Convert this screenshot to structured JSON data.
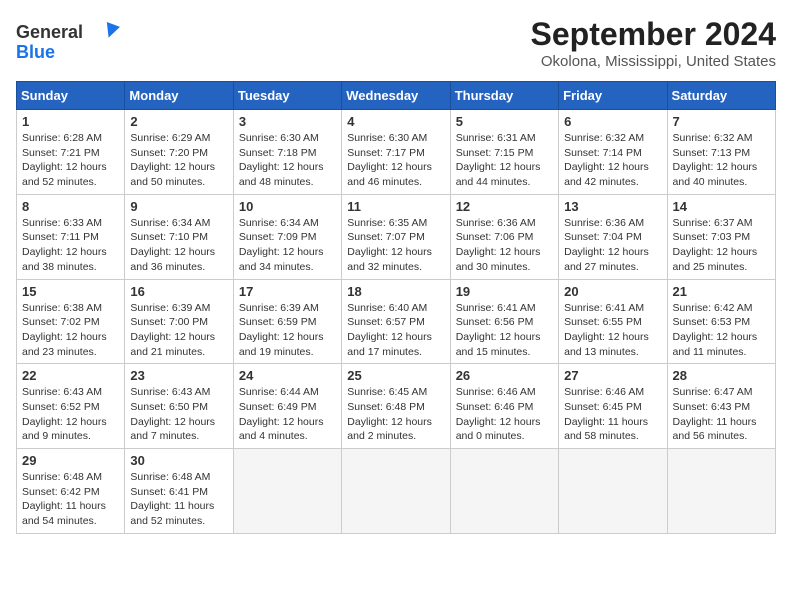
{
  "header": {
    "logo_line1": "General",
    "logo_line2": "Blue",
    "title": "September 2024",
    "subtitle": "Okolona, Mississippi, United States"
  },
  "weekdays": [
    "Sunday",
    "Monday",
    "Tuesday",
    "Wednesday",
    "Thursday",
    "Friday",
    "Saturday"
  ],
  "weeks": [
    [
      {
        "day": "1",
        "sunrise": "Sunrise: 6:28 AM",
        "sunset": "Sunset: 7:21 PM",
        "daylight": "Daylight: 12 hours and 52 minutes."
      },
      {
        "day": "2",
        "sunrise": "Sunrise: 6:29 AM",
        "sunset": "Sunset: 7:20 PM",
        "daylight": "Daylight: 12 hours and 50 minutes."
      },
      {
        "day": "3",
        "sunrise": "Sunrise: 6:30 AM",
        "sunset": "Sunset: 7:18 PM",
        "daylight": "Daylight: 12 hours and 48 minutes."
      },
      {
        "day": "4",
        "sunrise": "Sunrise: 6:30 AM",
        "sunset": "Sunset: 7:17 PM",
        "daylight": "Daylight: 12 hours and 46 minutes."
      },
      {
        "day": "5",
        "sunrise": "Sunrise: 6:31 AM",
        "sunset": "Sunset: 7:15 PM",
        "daylight": "Daylight: 12 hours and 44 minutes."
      },
      {
        "day": "6",
        "sunrise": "Sunrise: 6:32 AM",
        "sunset": "Sunset: 7:14 PM",
        "daylight": "Daylight: 12 hours and 42 minutes."
      },
      {
        "day": "7",
        "sunrise": "Sunrise: 6:32 AM",
        "sunset": "Sunset: 7:13 PM",
        "daylight": "Daylight: 12 hours and 40 minutes."
      }
    ],
    [
      {
        "day": "8",
        "sunrise": "Sunrise: 6:33 AM",
        "sunset": "Sunset: 7:11 PM",
        "daylight": "Daylight: 12 hours and 38 minutes."
      },
      {
        "day": "9",
        "sunrise": "Sunrise: 6:34 AM",
        "sunset": "Sunset: 7:10 PM",
        "daylight": "Daylight: 12 hours and 36 minutes."
      },
      {
        "day": "10",
        "sunrise": "Sunrise: 6:34 AM",
        "sunset": "Sunset: 7:09 PM",
        "daylight": "Daylight: 12 hours and 34 minutes."
      },
      {
        "day": "11",
        "sunrise": "Sunrise: 6:35 AM",
        "sunset": "Sunset: 7:07 PM",
        "daylight": "Daylight: 12 hours and 32 minutes."
      },
      {
        "day": "12",
        "sunrise": "Sunrise: 6:36 AM",
        "sunset": "Sunset: 7:06 PM",
        "daylight": "Daylight: 12 hours and 30 minutes."
      },
      {
        "day": "13",
        "sunrise": "Sunrise: 6:36 AM",
        "sunset": "Sunset: 7:04 PM",
        "daylight": "Daylight: 12 hours and 27 minutes."
      },
      {
        "day": "14",
        "sunrise": "Sunrise: 6:37 AM",
        "sunset": "Sunset: 7:03 PM",
        "daylight": "Daylight: 12 hours and 25 minutes."
      }
    ],
    [
      {
        "day": "15",
        "sunrise": "Sunrise: 6:38 AM",
        "sunset": "Sunset: 7:02 PM",
        "daylight": "Daylight: 12 hours and 23 minutes."
      },
      {
        "day": "16",
        "sunrise": "Sunrise: 6:39 AM",
        "sunset": "Sunset: 7:00 PM",
        "daylight": "Daylight: 12 hours and 21 minutes."
      },
      {
        "day": "17",
        "sunrise": "Sunrise: 6:39 AM",
        "sunset": "Sunset: 6:59 PM",
        "daylight": "Daylight: 12 hours and 19 minutes."
      },
      {
        "day": "18",
        "sunrise": "Sunrise: 6:40 AM",
        "sunset": "Sunset: 6:57 PM",
        "daylight": "Daylight: 12 hours and 17 minutes."
      },
      {
        "day": "19",
        "sunrise": "Sunrise: 6:41 AM",
        "sunset": "Sunset: 6:56 PM",
        "daylight": "Daylight: 12 hours and 15 minutes."
      },
      {
        "day": "20",
        "sunrise": "Sunrise: 6:41 AM",
        "sunset": "Sunset: 6:55 PM",
        "daylight": "Daylight: 12 hours and 13 minutes."
      },
      {
        "day": "21",
        "sunrise": "Sunrise: 6:42 AM",
        "sunset": "Sunset: 6:53 PM",
        "daylight": "Daylight: 12 hours and 11 minutes."
      }
    ],
    [
      {
        "day": "22",
        "sunrise": "Sunrise: 6:43 AM",
        "sunset": "Sunset: 6:52 PM",
        "daylight": "Daylight: 12 hours and 9 minutes."
      },
      {
        "day": "23",
        "sunrise": "Sunrise: 6:43 AM",
        "sunset": "Sunset: 6:50 PM",
        "daylight": "Daylight: 12 hours and 7 minutes."
      },
      {
        "day": "24",
        "sunrise": "Sunrise: 6:44 AM",
        "sunset": "Sunset: 6:49 PM",
        "daylight": "Daylight: 12 hours and 4 minutes."
      },
      {
        "day": "25",
        "sunrise": "Sunrise: 6:45 AM",
        "sunset": "Sunset: 6:48 PM",
        "daylight": "Daylight: 12 hours and 2 minutes."
      },
      {
        "day": "26",
        "sunrise": "Sunrise: 6:46 AM",
        "sunset": "Sunset: 6:46 PM",
        "daylight": "Daylight: 12 hours and 0 minutes."
      },
      {
        "day": "27",
        "sunrise": "Sunrise: 6:46 AM",
        "sunset": "Sunset: 6:45 PM",
        "daylight": "Daylight: 11 hours and 58 minutes."
      },
      {
        "day": "28",
        "sunrise": "Sunrise: 6:47 AM",
        "sunset": "Sunset: 6:43 PM",
        "daylight": "Daylight: 11 hours and 56 minutes."
      }
    ],
    [
      {
        "day": "29",
        "sunrise": "Sunrise: 6:48 AM",
        "sunset": "Sunset: 6:42 PM",
        "daylight": "Daylight: 11 hours and 54 minutes."
      },
      {
        "day": "30",
        "sunrise": "Sunrise: 6:48 AM",
        "sunset": "Sunset: 6:41 PM",
        "daylight": "Daylight: 11 hours and 52 minutes."
      },
      null,
      null,
      null,
      null,
      null
    ]
  ]
}
